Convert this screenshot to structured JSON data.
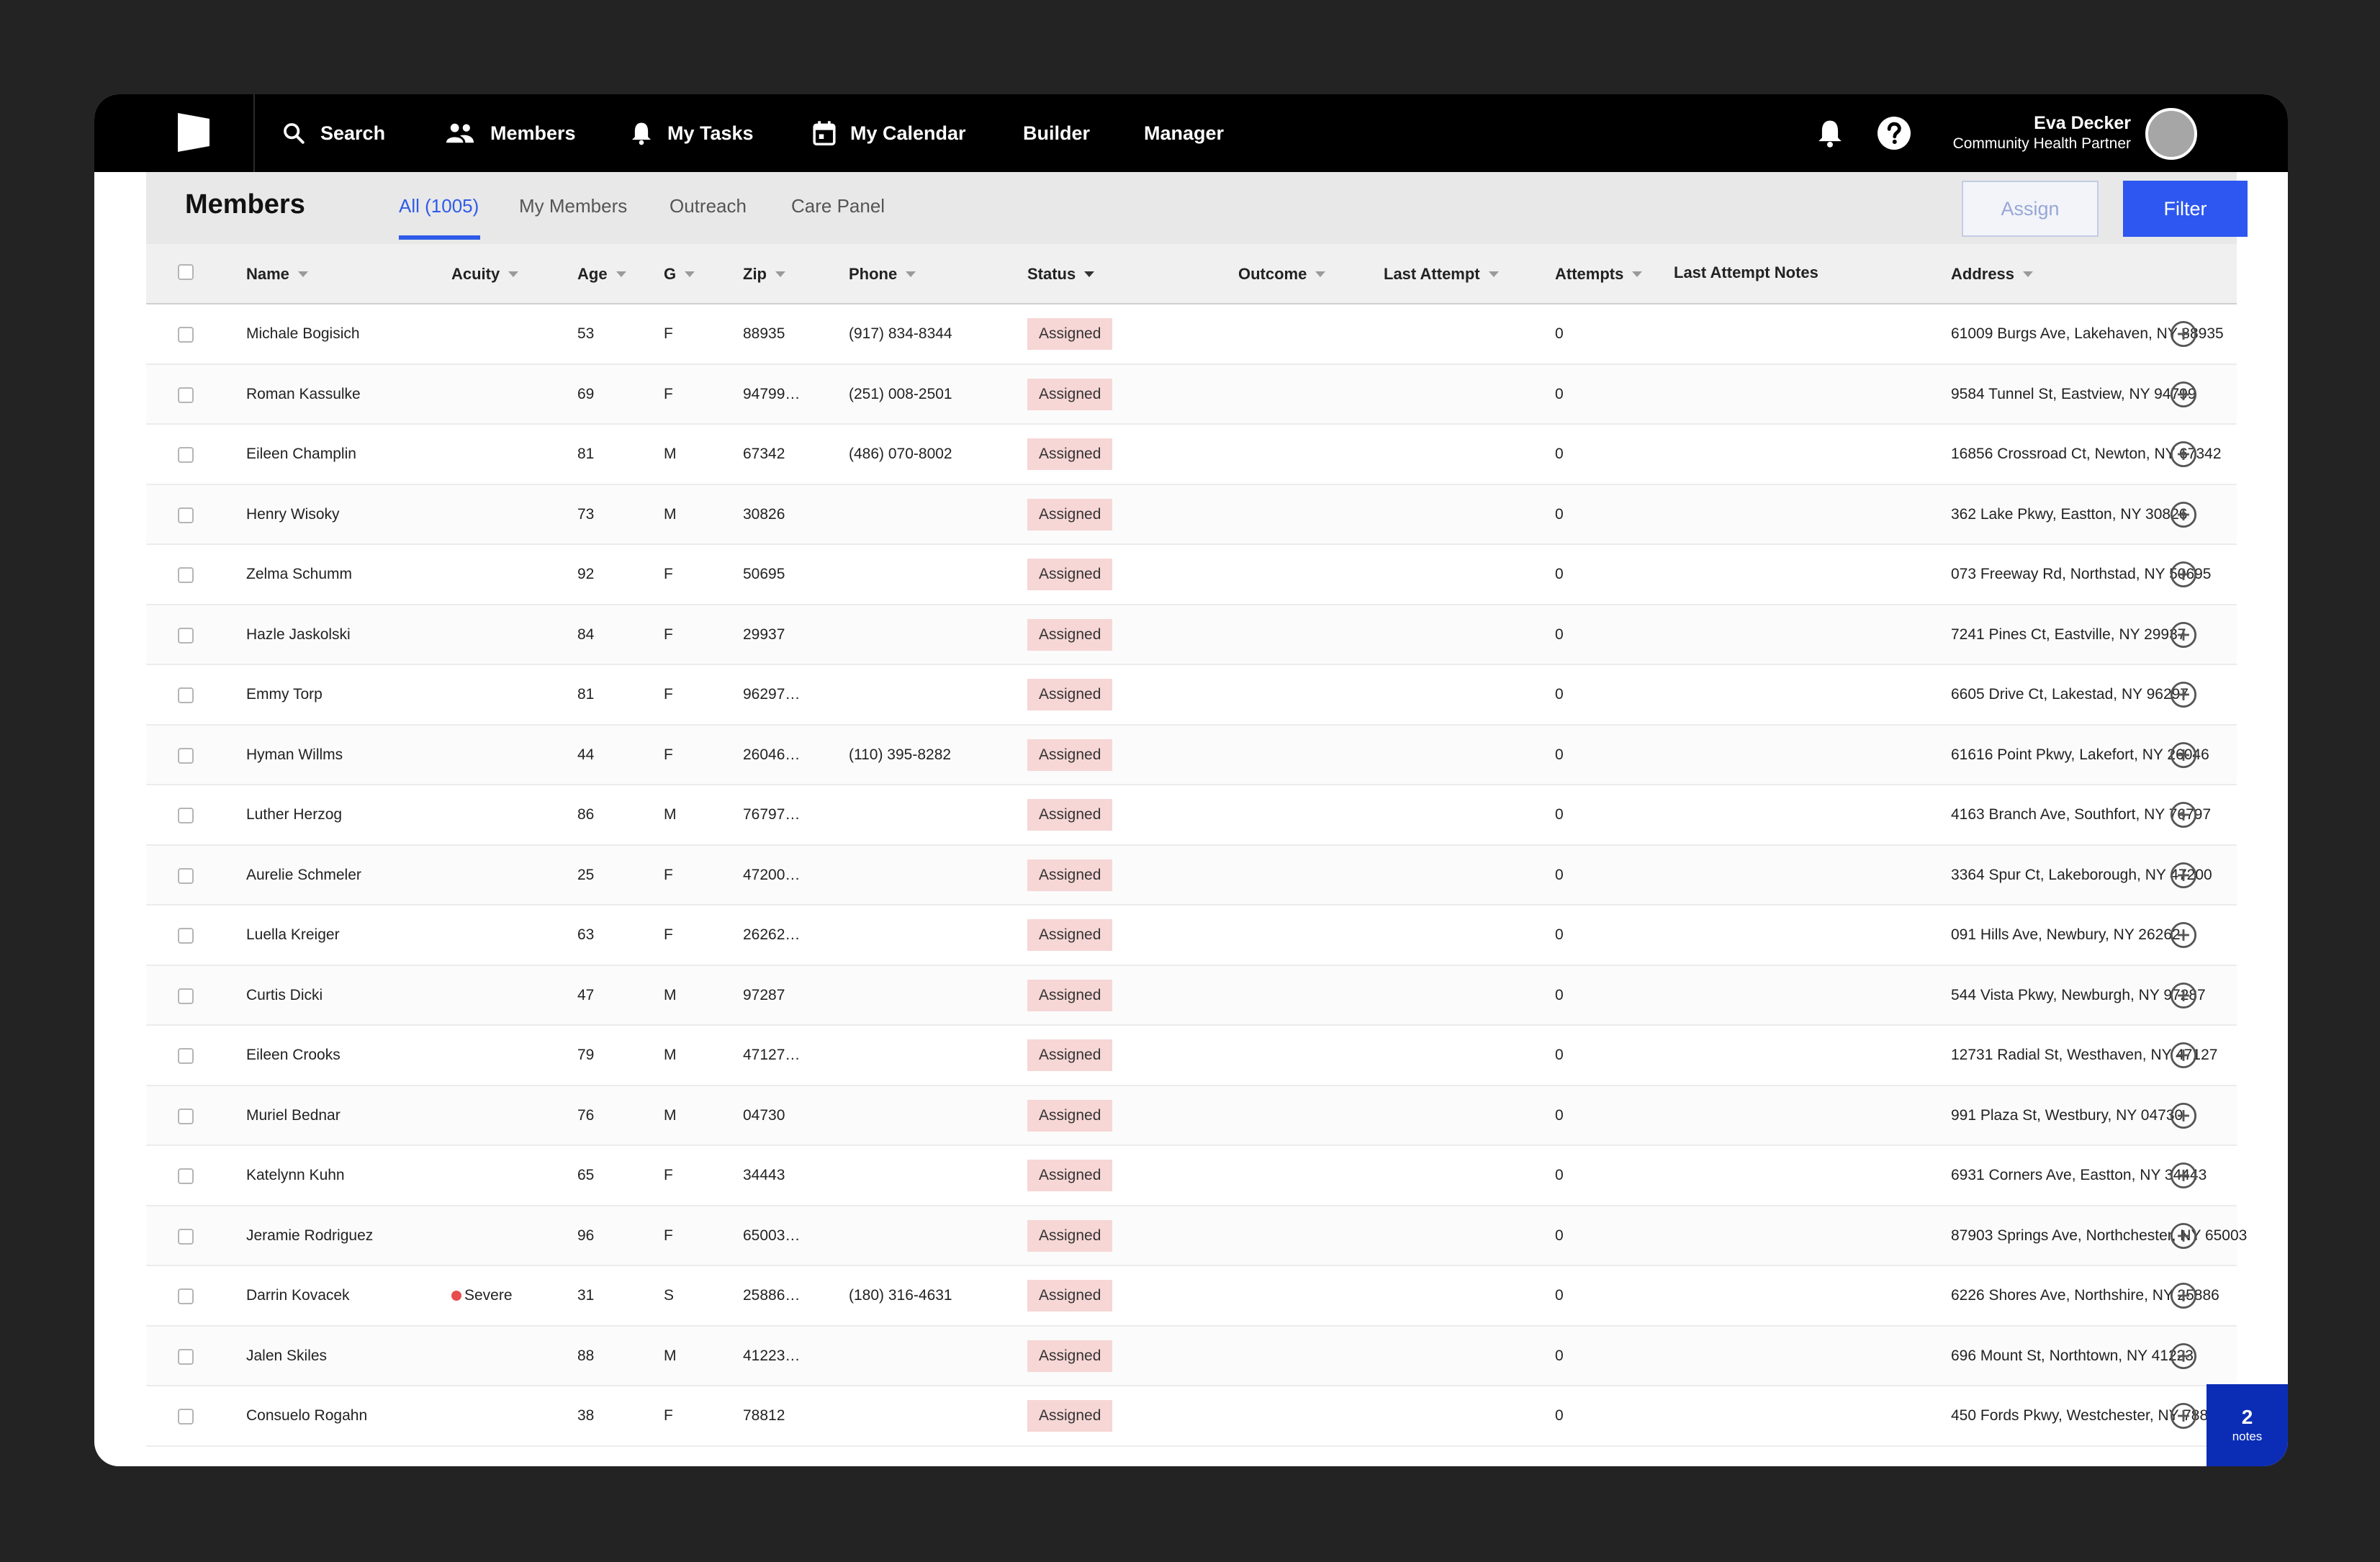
{
  "nav": {
    "search": "Search",
    "members": "Members",
    "tasks": "My Tasks",
    "calendar": "My Calendar",
    "builder": "Builder",
    "manager": "Manager"
  },
  "user": {
    "name": "Eva Decker",
    "role": "Community Health Partner"
  },
  "page": {
    "title": "Members",
    "tabs": [
      "All (1005)",
      "My Members",
      "Outreach",
      "Care Panel"
    ],
    "assign_label": "Assign",
    "filter_label": "Filter"
  },
  "table": {
    "columns": {
      "name": "Name",
      "acuity": "Acuity",
      "age": "Age",
      "g": "G",
      "zip": "Zip",
      "phone": "Phone",
      "status": "Status",
      "outcome": "Outcome",
      "last_attempt": "Last Attempt",
      "attempts": "Attempts",
      "last_attempt_notes": "Last Attempt Notes",
      "address": "Address"
    },
    "rows": [
      {
        "name": "Michale Bogisich",
        "acuity": "",
        "age": "53",
        "g": "F",
        "zip": "88935",
        "phone": "(917) 834-8344",
        "status": "Assigned",
        "attempts": "0",
        "address": "61009 Burgs Ave, Lakehaven, NY 88935"
      },
      {
        "name": "Roman Kassulke",
        "acuity": "",
        "age": "69",
        "g": "F",
        "zip": "94799…",
        "phone": "(251) 008-2501",
        "status": "Assigned",
        "attempts": "0",
        "address": "9584 Tunnel St, Eastview, NY 94799"
      },
      {
        "name": "Eileen Champlin",
        "acuity": "",
        "age": "81",
        "g": "M",
        "zip": "67342",
        "phone": "(486) 070-8002",
        "status": "Assigned",
        "attempts": "0",
        "address": "16856 Crossroad Ct, Newton, NY 67342"
      },
      {
        "name": "Henry Wisoky",
        "acuity": "",
        "age": "73",
        "g": "M",
        "zip": "30826",
        "phone": "",
        "status": "Assigned",
        "attempts": "0",
        "address": "362 Lake Pkwy, Eastton, NY 30826"
      },
      {
        "name": "Zelma Schumm",
        "acuity": "",
        "age": "92",
        "g": "F",
        "zip": "50695",
        "phone": "",
        "status": "Assigned",
        "attempts": "0",
        "address": "073 Freeway Rd, Northstad, NY 50695"
      },
      {
        "name": "Hazle Jaskolski",
        "acuity": "",
        "age": "84",
        "g": "F",
        "zip": "29937",
        "phone": "",
        "status": "Assigned",
        "attempts": "0",
        "address": "7241 Pines Ct, Eastville, NY 29937"
      },
      {
        "name": "Emmy Torp",
        "acuity": "",
        "age": "81",
        "g": "F",
        "zip": "96297…",
        "phone": "",
        "status": "Assigned",
        "attempts": "0",
        "address": "6605 Drive Ct, Lakestad, NY 96297"
      },
      {
        "name": "Hyman Willms",
        "acuity": "",
        "age": "44",
        "g": "F",
        "zip": "26046…",
        "phone": "(110) 395-8282",
        "status": "Assigned",
        "attempts": "0",
        "address": "61616 Point Pkwy, Lakefort, NY 26046"
      },
      {
        "name": "Luther Herzog",
        "acuity": "",
        "age": "86",
        "g": "M",
        "zip": "76797…",
        "phone": "",
        "status": "Assigned",
        "attempts": "0",
        "address": "4163 Branch Ave, Southfort, NY 76797"
      },
      {
        "name": "Aurelie Schmeler",
        "acuity": "",
        "age": "25",
        "g": "F",
        "zip": "47200…",
        "phone": "",
        "status": "Assigned",
        "attempts": "0",
        "address": "3364 Spur Ct, Lakeborough, NY 47200"
      },
      {
        "name": "Luella Kreiger",
        "acuity": "",
        "age": "63",
        "g": "F",
        "zip": "26262…",
        "phone": "",
        "status": "Assigned",
        "attempts": "0",
        "address": "091 Hills Ave, Newbury, NY 26262"
      },
      {
        "name": "Curtis Dicki",
        "acuity": "",
        "age": "47",
        "g": "M",
        "zip": "97287",
        "phone": "",
        "status": "Assigned",
        "attempts": "0",
        "address": "544 Vista Pkwy, Newburgh, NY 97287"
      },
      {
        "name": "Eileen Crooks",
        "acuity": "",
        "age": "79",
        "g": "M",
        "zip": "47127…",
        "phone": "",
        "status": "Assigned",
        "attempts": "0",
        "address": "12731 Radial St, Westhaven, NY 47127"
      },
      {
        "name": "Muriel Bednar",
        "acuity": "",
        "age": "76",
        "g": "M",
        "zip": "04730",
        "phone": "",
        "status": "Assigned",
        "attempts": "0",
        "address": "991 Plaza St, Westbury, NY 04730"
      },
      {
        "name": "Katelynn Kuhn",
        "acuity": "",
        "age": "65",
        "g": "F",
        "zip": "34443",
        "phone": "",
        "status": "Assigned",
        "attempts": "0",
        "address": "6931 Corners Ave, Eastton, NY 34443"
      },
      {
        "name": "Jeramie Rodriguez",
        "acuity": "",
        "age": "96",
        "g": "F",
        "zip": "65003…",
        "phone": "",
        "status": "Assigned",
        "attempts": "0",
        "address": "87903 Springs Ave, Northchester, NY 65003"
      },
      {
        "name": "Darrin Kovacek",
        "acuity": "Severe",
        "age": "31",
        "g": "S",
        "zip": "25886…",
        "phone": "(180) 316-4631",
        "status": "Assigned",
        "attempts": "0",
        "address": "6226 Shores Ave, Northshire, NY 25886"
      },
      {
        "name": "Jalen Skiles",
        "acuity": "",
        "age": "88",
        "g": "M",
        "zip": "41223…",
        "phone": "",
        "status": "Assigned",
        "attempts": "0",
        "address": "696 Mount St, Northtown, NY 41223"
      },
      {
        "name": "Consuelo Rogahn",
        "acuity": "",
        "age": "38",
        "g": "F",
        "zip": "78812",
        "phone": "",
        "status": "Assigned",
        "attempts": "0",
        "address": "450 Fords Pkwy, Westchester, NY 78812"
      }
    ]
  },
  "notes": {
    "count": "2",
    "label": "notes"
  },
  "colors": {
    "accent": "#2d57f0",
    "status_badge": "#f7d6d6",
    "severe": "#e84c4c",
    "notes_bg": "#0b2db5"
  }
}
